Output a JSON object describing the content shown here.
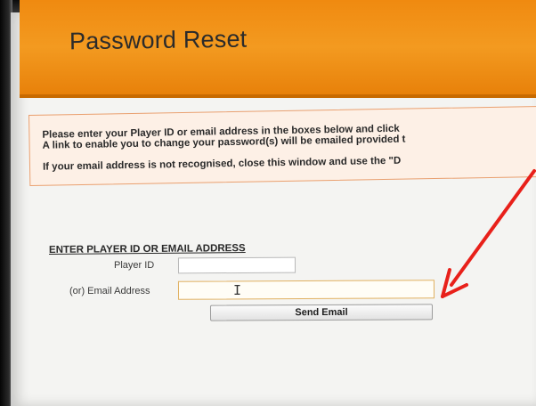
{
  "header": {
    "title": "Password Reset"
  },
  "notice": {
    "line1": "Please enter your Player ID or email address in the boxes below and click",
    "line2": "A link to enable you to change your password(s) will be emailed provided t",
    "line3": "If your email address is not recognised, close this window and use the \"D"
  },
  "form": {
    "heading": "ENTER PLAYER ID OR EMAIL ADDRESS",
    "player_id_label": "Player ID",
    "player_id_value": "",
    "email_label": "(or) Email Address",
    "email_value": "",
    "send_label": "Send Email"
  },
  "colors": {
    "banner": "#f08a10",
    "notice_border": "#e9a070",
    "email_field_border": "#e0b060",
    "annotation_arrow": "#e8201a"
  },
  "icons": {
    "cursor": "text-cursor-icon",
    "annotation": "red-arrow-icon"
  }
}
